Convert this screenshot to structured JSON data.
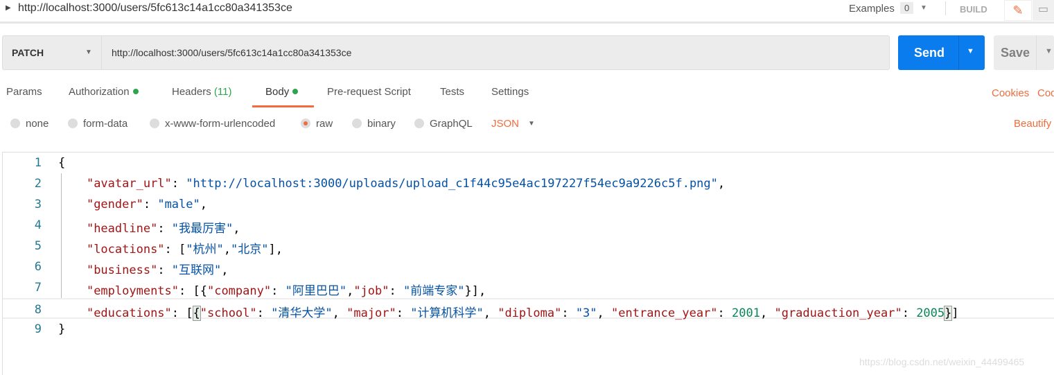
{
  "topbar": {
    "title": "http://localhost:3000/users/5fc613c14a1cc80a341353ce",
    "examples_label": "Examples",
    "examples_count": "0",
    "build_label": "BUILD"
  },
  "request": {
    "method": "PATCH",
    "url": "http://localhost:3000/users/5fc613c14a1cc80a341353ce",
    "send_label": "Send",
    "save_label": "Save"
  },
  "tabs": [
    {
      "label": "Params"
    },
    {
      "label": "Authorization",
      "dot": true
    },
    {
      "label": "Headers",
      "count": "(11)"
    },
    {
      "label": "Body",
      "dot": true,
      "active": true
    },
    {
      "label": "Pre-request Script"
    },
    {
      "label": "Tests"
    },
    {
      "label": "Settings"
    }
  ],
  "links": {
    "cookies": "Cookies",
    "code": "Code",
    "beautify": "Beautify"
  },
  "body_options": [
    {
      "label": "none"
    },
    {
      "label": "form-data"
    },
    {
      "label": "x-www-form-urlencoded"
    },
    {
      "label": "raw",
      "selected": true
    },
    {
      "label": "binary"
    },
    {
      "label": "GraphQL"
    }
  ],
  "raw_format": "JSON",
  "colors": {
    "accent": "#f26b3a",
    "send": "#0b7ced",
    "key": "#a31515",
    "string": "#0451a5",
    "number": "#098658",
    "line_number": "#237893"
  },
  "editor": {
    "lines": [
      [
        [
          "p",
          "{"
        ]
      ],
      [
        [
          "p",
          "    "
        ],
        [
          "k",
          "\"avatar_url\""
        ],
        [
          "p",
          ": "
        ],
        [
          "s",
          "\"http://localhost:3000/uploads/upload_c1f44c95e4ac197227f54ec9a9226c5f.png\""
        ],
        [
          "p",
          ","
        ]
      ],
      [
        [
          "p",
          "    "
        ],
        [
          "k",
          "\"gender\""
        ],
        [
          "p",
          ": "
        ],
        [
          "s",
          "\"male\""
        ],
        [
          "p",
          ","
        ]
      ],
      [
        [
          "p",
          "    "
        ],
        [
          "k",
          "\"headline\""
        ],
        [
          "p",
          ": "
        ],
        [
          "s",
          "\"我最厉害\""
        ],
        [
          "p",
          ","
        ]
      ],
      [
        [
          "p",
          "    "
        ],
        [
          "k",
          "\"locations\""
        ],
        [
          "p",
          ": ["
        ],
        [
          "s",
          "\"杭州\""
        ],
        [
          "p",
          ","
        ],
        [
          "s",
          "\"北京\""
        ],
        [
          "p",
          "],"
        ]
      ],
      [
        [
          "p",
          "    "
        ],
        [
          "k",
          "\"business\""
        ],
        [
          "p",
          ": "
        ],
        [
          "s",
          "\"互联网\""
        ],
        [
          "p",
          ","
        ]
      ],
      [
        [
          "p",
          "    "
        ],
        [
          "k",
          "\"employments\""
        ],
        [
          "p",
          ": [{"
        ],
        [
          "k",
          "\"company\""
        ],
        [
          "p",
          ": "
        ],
        [
          "s",
          "\"阿里巴巴\""
        ],
        [
          "p",
          ","
        ],
        [
          "k",
          "\"job\""
        ],
        [
          "p",
          ": "
        ],
        [
          "s",
          "\"前端专家\""
        ],
        [
          "p",
          "}],"
        ]
      ],
      [
        [
          "p",
          "    "
        ],
        [
          "k",
          "\"educations\""
        ],
        [
          "p",
          ": ["
        ],
        [
          "h",
          "{"
        ],
        [
          "k",
          "\"school\""
        ],
        [
          "p",
          ": "
        ],
        [
          "s",
          "\"清华大学\""
        ],
        [
          "p",
          ", "
        ],
        [
          "k",
          "\"major\""
        ],
        [
          "p",
          ": "
        ],
        [
          "s",
          "\"计算机科学\""
        ],
        [
          "p",
          ", "
        ],
        [
          "k",
          "\"diploma\""
        ],
        [
          "p",
          ": "
        ],
        [
          "s",
          "\"3\""
        ],
        [
          "p",
          ", "
        ],
        [
          "k",
          "\"entrance_year\""
        ],
        [
          "p",
          ": "
        ],
        [
          "n",
          "2001"
        ],
        [
          "p",
          ", "
        ],
        [
          "k",
          "\"graduaction_year\""
        ],
        [
          "p",
          ": "
        ],
        [
          "n",
          "2005"
        ],
        [
          "h",
          "}"
        ],
        [
          "p",
          "]"
        ]
      ],
      [
        [
          "p",
          "}"
        ]
      ]
    ]
  },
  "watermark": "https://blog.csdn.net/weixin_44499465"
}
